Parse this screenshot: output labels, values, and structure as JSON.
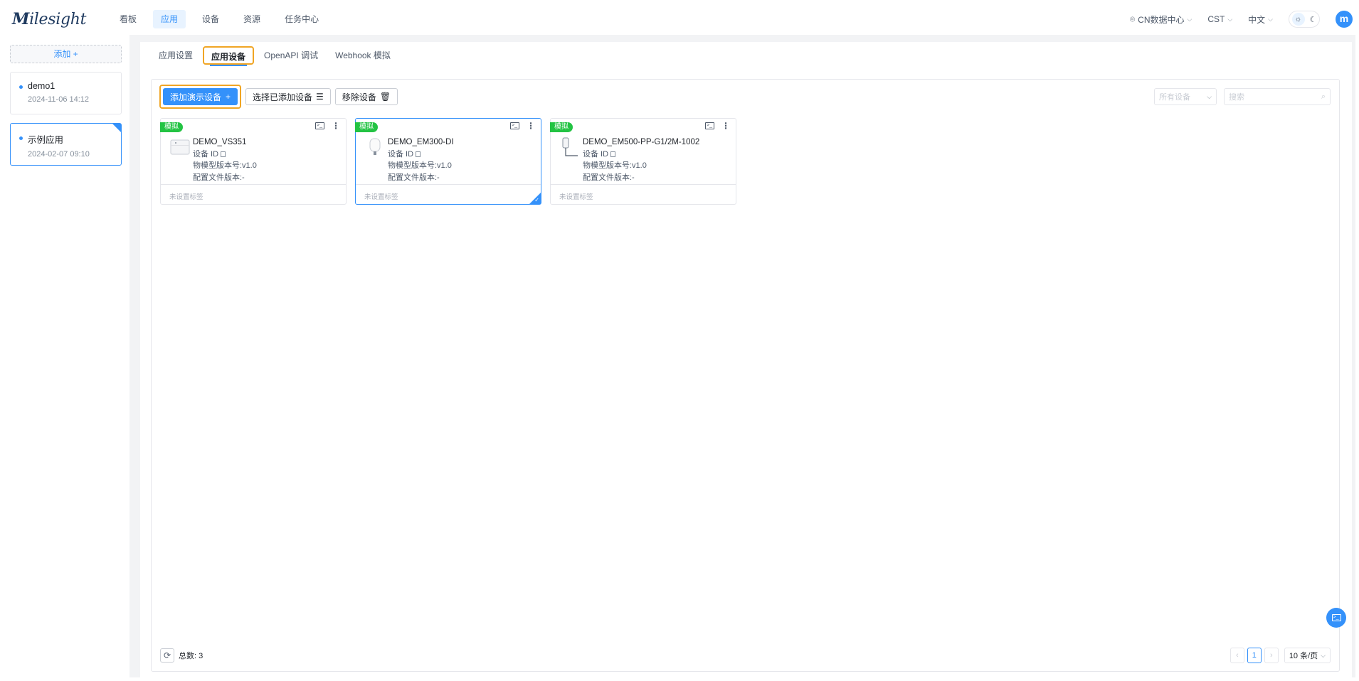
{
  "brand": {
    "logo_m": "M",
    "logo_rest": "ilesight"
  },
  "nav": {
    "items": [
      {
        "label": "看板"
      },
      {
        "label": "应用"
      },
      {
        "label": "设备"
      },
      {
        "label": "资源"
      },
      {
        "label": "任务中心"
      }
    ],
    "active_index": 1
  },
  "topright": {
    "datacenter": "CN数据中心",
    "timezone": "CST",
    "language": "中文",
    "avatar": "m"
  },
  "sidebar": {
    "add_label": "添加",
    "apps": [
      {
        "name": "demo1",
        "date": "2024-11-06 14:12"
      },
      {
        "name": "示例应用",
        "date": "2024-02-07 09:10"
      }
    ],
    "selected_index": 1
  },
  "tabs": [
    {
      "label": "应用设置"
    },
    {
      "label": "应用设备"
    },
    {
      "label": "OpenAPI 调试"
    },
    {
      "label": "Webhook 模拟"
    }
  ],
  "toolbar": {
    "add_demo": "添加演示设备",
    "select_added": "选择已添加设备",
    "remove": "移除设备",
    "filter_placeholder": "所有设备",
    "search_placeholder": "搜索"
  },
  "cards": [
    {
      "badge": "模拟",
      "name": "DEMO_VS351",
      "id_label": "设备 ID",
      "model_version": "物模型版本号:v1.0",
      "config_version": "配置文件版本:-",
      "tag": "未设置标签"
    },
    {
      "badge": "模拟",
      "name": "DEMO_EM300-DI",
      "id_label": "设备 ID",
      "model_version": "物模型版本号:v1.0",
      "config_version": "配置文件版本:-",
      "tag": "未设置标签"
    },
    {
      "badge": "模拟",
      "name": "DEMO_EM500-PP-G1/2M-1002",
      "id_label": "设备 ID",
      "model_version": "物模型版本号:v1.0",
      "config_version": "配置文件版本:-",
      "tag": "未设置标签"
    }
  ],
  "footer": {
    "total": "总数:  3",
    "current_page": "1",
    "page_size": "10 条/页"
  },
  "colors": {
    "accent": "#3491fa",
    "badge": "#23c343",
    "highlight": "#f0a524"
  }
}
